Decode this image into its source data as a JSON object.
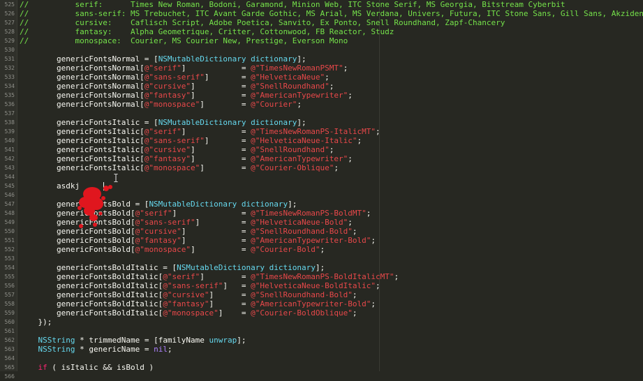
{
  "editor": {
    "lines": [
      {
        "n": "525",
        "tokens": [
          {
            "t": "//          serif:      Times New Roman, Bodoni, Garamond, Minion Web, ITC Stone Serif, MS Georgia, Bitstream Cyberbit",
            "c": "comment"
          }
        ]
      },
      {
        "n": "526",
        "tokens": [
          {
            "t": "//          sans-serif: MS Trebuchet, ITC Avant Garde Gothic, MS Arial, MS Verdana, Univers, Futura, ITC Stone Sans, Gill Sans, Akzidenz",
            "c": "comment"
          }
        ]
      },
      {
        "n": "527",
        "tokens": [
          {
            "t": "//          cursive:    Caflisch Script, Adobe Poetica, Sanvito, Ex Ponto, Snell Roundhand, Zapf-Chancery",
            "c": "comment"
          }
        ]
      },
      {
        "n": "528",
        "tokens": [
          {
            "t": "//          fantasy:    Alpha Geometrique, Critter, Cottonwood, FB Reactor, Studz",
            "c": "comment"
          }
        ]
      },
      {
        "n": "529",
        "tokens": [
          {
            "t": "//          monospace:  Courier, MS Courier New, Prestige, Everson Mono",
            "c": "comment"
          }
        ]
      },
      {
        "n": "530",
        "tokens": []
      },
      {
        "n": "531",
        "tokens": [
          {
            "t": "        genericFontsNormal = [",
            "c": "plain"
          },
          {
            "t": "NSMutableDictionary dictionary",
            "c": "class"
          },
          {
            "t": "];",
            "c": "plain"
          }
        ]
      },
      {
        "n": "532",
        "tokens": [
          {
            "t": "        genericFontsNormal[",
            "c": "plain"
          },
          {
            "t": "@\"serif\"",
            "c": "string"
          },
          {
            "t": "]            = ",
            "c": "plain"
          },
          {
            "t": "@\"TimesNewRomanPSMT\"",
            "c": "string"
          },
          {
            "t": ";",
            "c": "plain"
          }
        ]
      },
      {
        "n": "533",
        "tokens": [
          {
            "t": "        genericFontsNormal[",
            "c": "plain"
          },
          {
            "t": "@\"sans-serif\"",
            "c": "string"
          },
          {
            "t": "]       = ",
            "c": "plain"
          },
          {
            "t": "@\"HelveticaNeue\"",
            "c": "string"
          },
          {
            "t": ";",
            "c": "plain"
          }
        ]
      },
      {
        "n": "534",
        "tokens": [
          {
            "t": "        genericFontsNormal[",
            "c": "plain"
          },
          {
            "t": "@\"cursive\"",
            "c": "string"
          },
          {
            "t": "]          = ",
            "c": "plain"
          },
          {
            "t": "@\"SnellRoundhand\"",
            "c": "string"
          },
          {
            "t": ";",
            "c": "plain"
          }
        ]
      },
      {
        "n": "535",
        "tokens": [
          {
            "t": "        genericFontsNormal[",
            "c": "plain"
          },
          {
            "t": "@\"fantasy\"",
            "c": "string"
          },
          {
            "t": "]          = ",
            "c": "plain"
          },
          {
            "t": "@\"AmericanTypewriter\"",
            "c": "string"
          },
          {
            "t": ";",
            "c": "plain"
          }
        ]
      },
      {
        "n": "536",
        "tokens": [
          {
            "t": "        genericFontsNormal[",
            "c": "plain"
          },
          {
            "t": "@\"monospace\"",
            "c": "string"
          },
          {
            "t": "]        = ",
            "c": "plain"
          },
          {
            "t": "@\"Courier\"",
            "c": "string"
          },
          {
            "t": ";",
            "c": "plain"
          }
        ]
      },
      {
        "n": "537",
        "tokens": []
      },
      {
        "n": "538",
        "tokens": [
          {
            "t": "        genericFontsItalic = [",
            "c": "plain"
          },
          {
            "t": "NSMutableDictionary dictionary",
            "c": "class"
          },
          {
            "t": "];",
            "c": "plain"
          }
        ]
      },
      {
        "n": "539",
        "tokens": [
          {
            "t": "        genericFontsItalic[",
            "c": "plain"
          },
          {
            "t": "@\"serif\"",
            "c": "string"
          },
          {
            "t": "]            = ",
            "c": "plain"
          },
          {
            "t": "@\"TimesNewRomanPS-ItalicMT\"",
            "c": "string"
          },
          {
            "t": ";",
            "c": "plain"
          }
        ]
      },
      {
        "n": "540",
        "tokens": [
          {
            "t": "        genericFontsItalic[",
            "c": "plain"
          },
          {
            "t": "@\"sans-serif\"",
            "c": "string"
          },
          {
            "t": "]       = ",
            "c": "plain"
          },
          {
            "t": "@\"HelveticaNeue-Italic\"",
            "c": "string"
          },
          {
            "t": ";",
            "c": "plain"
          }
        ]
      },
      {
        "n": "541",
        "tokens": [
          {
            "t": "        genericFontsItalic[",
            "c": "plain"
          },
          {
            "t": "@\"cursive\"",
            "c": "string"
          },
          {
            "t": "]          = ",
            "c": "plain"
          },
          {
            "t": "@\"SnellRoundhand\"",
            "c": "string"
          },
          {
            "t": ";",
            "c": "plain"
          }
        ]
      },
      {
        "n": "542",
        "tokens": [
          {
            "t": "        genericFontsItalic[",
            "c": "plain"
          },
          {
            "t": "@\"fantasy\"",
            "c": "string"
          },
          {
            "t": "]          = ",
            "c": "plain"
          },
          {
            "t": "@\"AmericanTypewriter\"",
            "c": "string"
          },
          {
            "t": ";",
            "c": "plain"
          }
        ]
      },
      {
        "n": "543",
        "tokens": [
          {
            "t": "        genericFontsItalic[",
            "c": "plain"
          },
          {
            "t": "@\"monospace\"",
            "c": "string"
          },
          {
            "t": "]        = ",
            "c": "plain"
          },
          {
            "t": "@\"Courier-Oblique\"",
            "c": "string"
          },
          {
            "t": ";",
            "c": "plain"
          }
        ]
      },
      {
        "n": "544",
        "tokens": []
      },
      {
        "n": "545",
        "tokens": [
          {
            "t": "        asdkj",
            "c": "plain"
          }
        ]
      },
      {
        "n": "546",
        "tokens": []
      },
      {
        "n": "547",
        "tokens": [
          {
            "t": "        genericFontsBold = [",
            "c": "plain"
          },
          {
            "t": "NSMutableDictionary dictionary",
            "c": "class"
          },
          {
            "t": "];",
            "c": "plain"
          }
        ]
      },
      {
        "n": "548",
        "tokens": [
          {
            "t": "        genericFontsBold[",
            "c": "plain"
          },
          {
            "t": "@\"serif\"",
            "c": "string"
          },
          {
            "t": "]              = ",
            "c": "plain"
          },
          {
            "t": "@\"TimesNewRomanPS-BoldMT\"",
            "c": "string"
          },
          {
            "t": ";",
            "c": "plain"
          }
        ]
      },
      {
        "n": "549",
        "tokens": [
          {
            "t": "        genericFontsBold[",
            "c": "plain"
          },
          {
            "t": "@\"sans-serif\"",
            "c": "string"
          },
          {
            "t": "]         = ",
            "c": "plain"
          },
          {
            "t": "@\"HelveticaNeue-Bold\"",
            "c": "string"
          },
          {
            "t": ";",
            "c": "plain"
          }
        ]
      },
      {
        "n": "550",
        "tokens": [
          {
            "t": "        genericFontsBold[",
            "c": "plain"
          },
          {
            "t": "@\"cursive\"",
            "c": "string"
          },
          {
            "t": "]            = ",
            "c": "plain"
          },
          {
            "t": "@\"SnellRoundhand-Bold\"",
            "c": "string"
          },
          {
            "t": ";",
            "c": "plain"
          }
        ]
      },
      {
        "n": "551",
        "tokens": [
          {
            "t": "        genericFontsBold[",
            "c": "plain"
          },
          {
            "t": "@\"fantasy\"",
            "c": "string"
          },
          {
            "t": "]            = ",
            "c": "plain"
          },
          {
            "t": "@\"AmericanTypewriter-Bold\"",
            "c": "string"
          },
          {
            "t": ";",
            "c": "plain"
          }
        ]
      },
      {
        "n": "552",
        "tokens": [
          {
            "t": "        genericFontsBold[",
            "c": "plain"
          },
          {
            "t": "@\"monospace\"",
            "c": "string"
          },
          {
            "t": "]          = ",
            "c": "plain"
          },
          {
            "t": "@\"Courier-Bold\"",
            "c": "string"
          },
          {
            "t": ";",
            "c": "plain"
          }
        ]
      },
      {
        "n": "553",
        "tokens": []
      },
      {
        "n": "554",
        "tokens": [
          {
            "t": "        genericFontsBoldItalic = [",
            "c": "plain"
          },
          {
            "t": "NSMutableDictionary dictionary",
            "c": "class"
          },
          {
            "t": "];",
            "c": "plain"
          }
        ]
      },
      {
        "n": "555",
        "tokens": [
          {
            "t": "        genericFontsBoldItalic[",
            "c": "plain"
          },
          {
            "t": "@\"serif\"",
            "c": "string"
          },
          {
            "t": "]        = ",
            "c": "plain"
          },
          {
            "t": "@\"TimesNewRomanPS-BoldItalicMT\"",
            "c": "string"
          },
          {
            "t": ";",
            "c": "plain"
          }
        ]
      },
      {
        "n": "556",
        "tokens": [
          {
            "t": "        genericFontsBoldItalic[",
            "c": "plain"
          },
          {
            "t": "@\"sans-serif\"",
            "c": "string"
          },
          {
            "t": "]   = ",
            "c": "plain"
          },
          {
            "t": "@\"HelveticaNeue-BoldItalic\"",
            "c": "string"
          },
          {
            "t": ";",
            "c": "plain"
          }
        ]
      },
      {
        "n": "557",
        "tokens": [
          {
            "t": "        genericFontsBoldItalic[",
            "c": "plain"
          },
          {
            "t": "@\"cursive\"",
            "c": "string"
          },
          {
            "t": "]      = ",
            "c": "plain"
          },
          {
            "t": "@\"SnellRoundhand-Bold\"",
            "c": "string"
          },
          {
            "t": ";",
            "c": "plain"
          }
        ]
      },
      {
        "n": "558",
        "tokens": [
          {
            "t": "        genericFontsBoldItalic[",
            "c": "plain"
          },
          {
            "t": "@\"fantasy\"",
            "c": "string"
          },
          {
            "t": "]      = ",
            "c": "plain"
          },
          {
            "t": "@\"AmericanTypewriter-Bold\"",
            "c": "string"
          },
          {
            "t": ";",
            "c": "plain"
          }
        ]
      },
      {
        "n": "559",
        "tokens": [
          {
            "t": "        genericFontsBoldItalic[",
            "c": "plain"
          },
          {
            "t": "@\"monospace\"",
            "c": "string"
          },
          {
            "t": "]    = ",
            "c": "plain"
          },
          {
            "t": "@\"Courier-BoldOblique\"",
            "c": "string"
          },
          {
            "t": ";",
            "c": "plain"
          }
        ]
      },
      {
        "n": "560",
        "tokens": [
          {
            "t": "    });",
            "c": "plain"
          }
        ]
      },
      {
        "n": "561",
        "tokens": []
      },
      {
        "n": "562",
        "tokens": [
          {
            "t": "    ",
            "c": "plain"
          },
          {
            "t": "NSString",
            "c": "class"
          },
          {
            "t": " * trimmedName = [familyName ",
            "c": "plain"
          },
          {
            "t": "unwrap",
            "c": "class"
          },
          {
            "t": "];",
            "c": "plain"
          }
        ]
      },
      {
        "n": "563",
        "tokens": [
          {
            "t": "    ",
            "c": "plain"
          },
          {
            "t": "NSString",
            "c": "class"
          },
          {
            "t": " * genericName = ",
            "c": "plain"
          },
          {
            "t": "nil",
            "c": "nil"
          },
          {
            "t": ";",
            "c": "plain"
          }
        ]
      },
      {
        "n": "564",
        "tokens": []
      },
      {
        "n": "565",
        "tokens": [
          {
            "t": "    ",
            "c": "plain"
          },
          {
            "t": "if",
            "c": "keyword"
          },
          {
            "t": " ( isItalic && isBold )",
            "c": "plain"
          }
        ]
      },
      {
        "n": "566",
        "tokens": []
      }
    ]
  },
  "colors": {
    "background": "#272822",
    "gutter": "#2f302a",
    "comment": "#75e24a",
    "plain": "#f8f8f2",
    "class": "#66d9ef",
    "string": "#e8484a",
    "keyword": "#f92672",
    "nil": "#ae81ff",
    "click_marker": "#e0161e"
  }
}
